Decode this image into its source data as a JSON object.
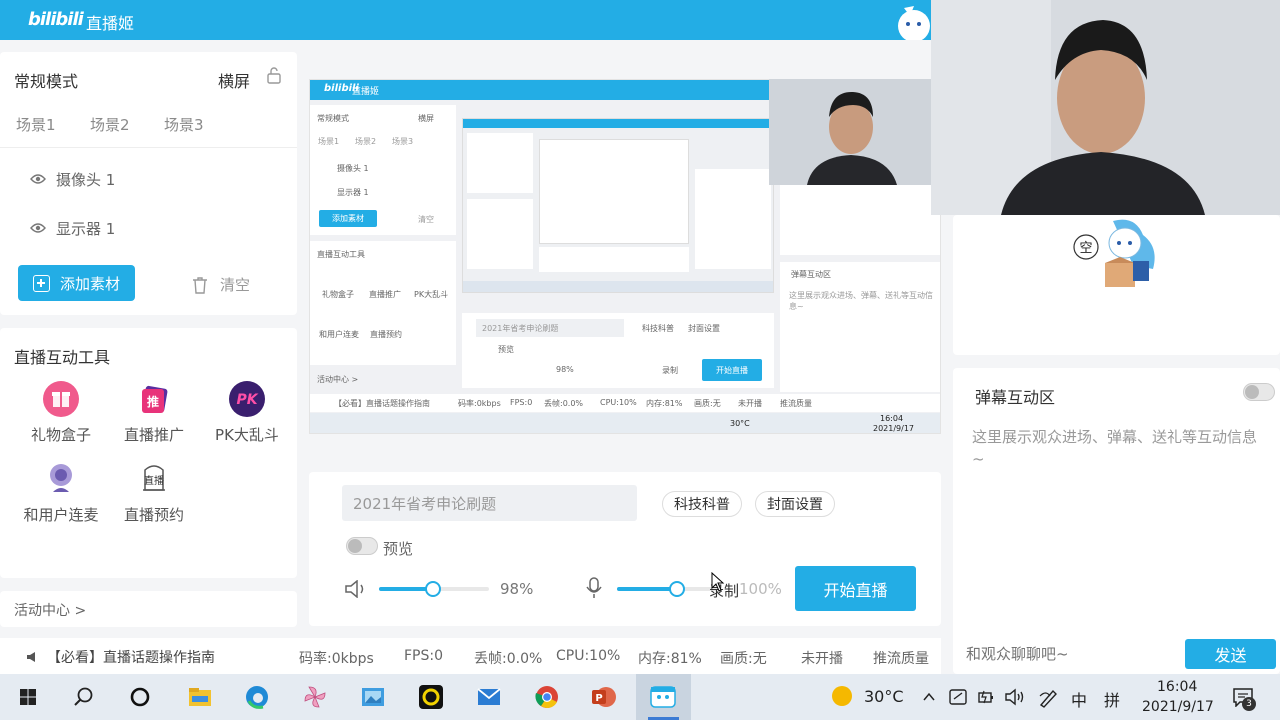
{
  "app": {
    "logo": "bilibili",
    "title": "直播姬"
  },
  "scenes": {
    "mode": "常规模式",
    "orientation": "横屏",
    "tabs": [
      "场景1",
      "场景2",
      "场景3"
    ],
    "sources": [
      "摄像头 1",
      "显示器 1"
    ],
    "add_label": "添加素材",
    "clear_label": "清空"
  },
  "tools": {
    "title": "直播互动工具",
    "items": [
      {
        "label": "礼物盒子",
        "icon": "gift-box-icon"
      },
      {
        "label": "直播推广",
        "icon": "promotion-icon"
      },
      {
        "label": "PK大乱斗",
        "icon": "pk-battle-icon"
      },
      {
        "label": "和用户连麦",
        "icon": "mic-link-icon"
      },
      {
        "label": "直播预约",
        "icon": "reservation-icon"
      }
    ],
    "pk_text": "PK",
    "reserve_text": "直播"
  },
  "activity": {
    "label": "活动中心 >"
  },
  "control": {
    "title_value": "2021年省考申论刷题",
    "category": "科技科普",
    "cover": "封面设置",
    "preview_label": "预览",
    "volume_pct": "98%",
    "volume_level": 0.49,
    "mic_level": 0.6,
    "mic_pct": "100%",
    "record_label": "录制",
    "start_label": "开始直播"
  },
  "status": {
    "guide": "【必看】直播话题操作指南",
    "bitrate": "码率:0kbps",
    "fps": "FPS:0",
    "drop": "丢帧:0.0%",
    "cpu": "CPU:10%",
    "memory": "内存:81%",
    "quality": "画质:无",
    "state": "未开播",
    "push_quality": "推流质量"
  },
  "danmaku": {
    "title": "弹幕互动区",
    "desc": "这里展示观众进场、弹幕、送礼等互动信息~",
    "placeholder": "和观众聊聊吧~",
    "send_label": "发送",
    "mascot_text": "空"
  },
  "taskbar": {
    "temp": "30°C",
    "ime_cn": "中",
    "ime_py": "拼",
    "time": "16:04",
    "date": "2021/9/17",
    "notif_count": "3"
  },
  "colors": {
    "accent": "#23ade5",
    "pink": "#f05a8c",
    "purple": "#5a2ea0"
  }
}
